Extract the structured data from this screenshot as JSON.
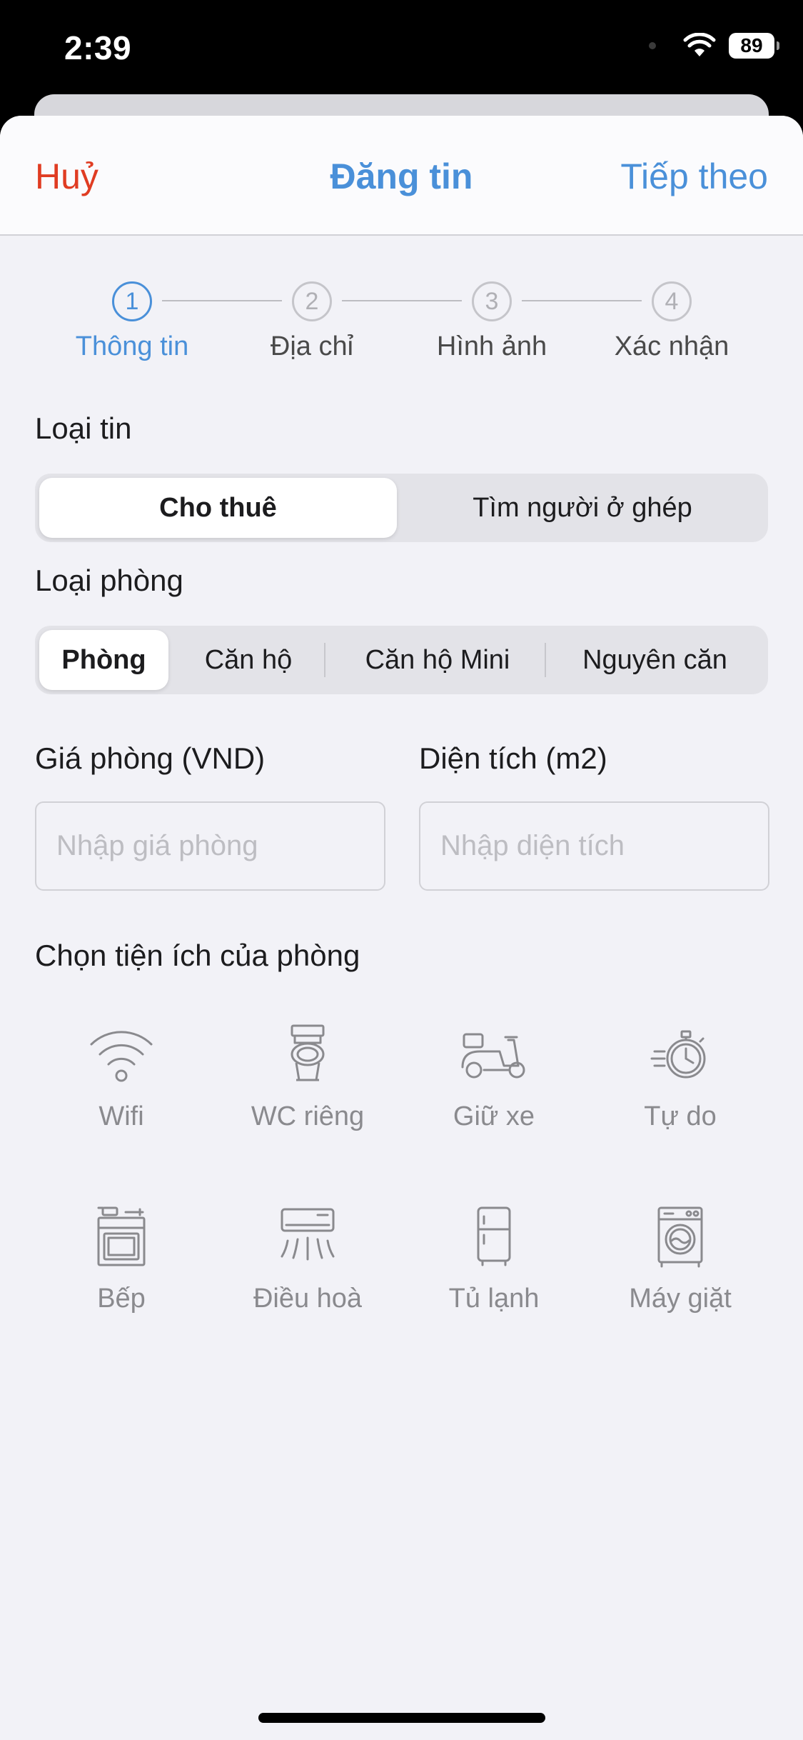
{
  "status_bar": {
    "time": "2:39",
    "battery": "89"
  },
  "nav": {
    "cancel": "Huỷ",
    "title": "Đăng tin",
    "next": "Tiếp theo"
  },
  "stepper": {
    "steps": [
      {
        "number": "1",
        "label": "Thông tin",
        "active": true
      },
      {
        "number": "2",
        "label": "Địa chỉ",
        "active": false
      },
      {
        "number": "3",
        "label": "Hình ảnh",
        "active": false
      },
      {
        "number": "4",
        "label": "Xác nhận",
        "active": false
      }
    ]
  },
  "listing_type": {
    "title": "Loại tin",
    "options": [
      "Cho thuê",
      "Tìm người ở ghép"
    ],
    "selected": "Cho thuê"
  },
  "room_type": {
    "title": "Loại phòng",
    "options": [
      "Phòng",
      "Căn hộ",
      "Căn hộ Mini",
      "Nguyên căn"
    ],
    "selected": "Phòng"
  },
  "price": {
    "label": "Giá phòng (VND)",
    "placeholder": "Nhập giá phòng",
    "value": ""
  },
  "area": {
    "label": "Diện tích (m2)",
    "placeholder": "Nhập diện tích",
    "value": ""
  },
  "amenities": {
    "title": "Chọn tiện ích của phòng",
    "items": [
      {
        "label": "Wifi",
        "icon": "wifi-icon"
      },
      {
        "label": "WC riêng",
        "icon": "toilet-icon"
      },
      {
        "label": "Giữ xe",
        "icon": "scooter-icon"
      },
      {
        "label": "Tự do",
        "icon": "stopwatch-icon"
      },
      {
        "label": "Bếp",
        "icon": "stove-icon"
      },
      {
        "label": "Điều hoà",
        "icon": "air-conditioner-icon"
      },
      {
        "label": "Tủ lạnh",
        "icon": "fridge-icon"
      },
      {
        "label": "Máy giặt",
        "icon": "washing-machine-icon"
      }
    ]
  },
  "colors": {
    "accent": "#4a90d9",
    "cancel": "#e03c22",
    "background": "#f2f2f7",
    "icon_gray": "#8a8a8e"
  }
}
